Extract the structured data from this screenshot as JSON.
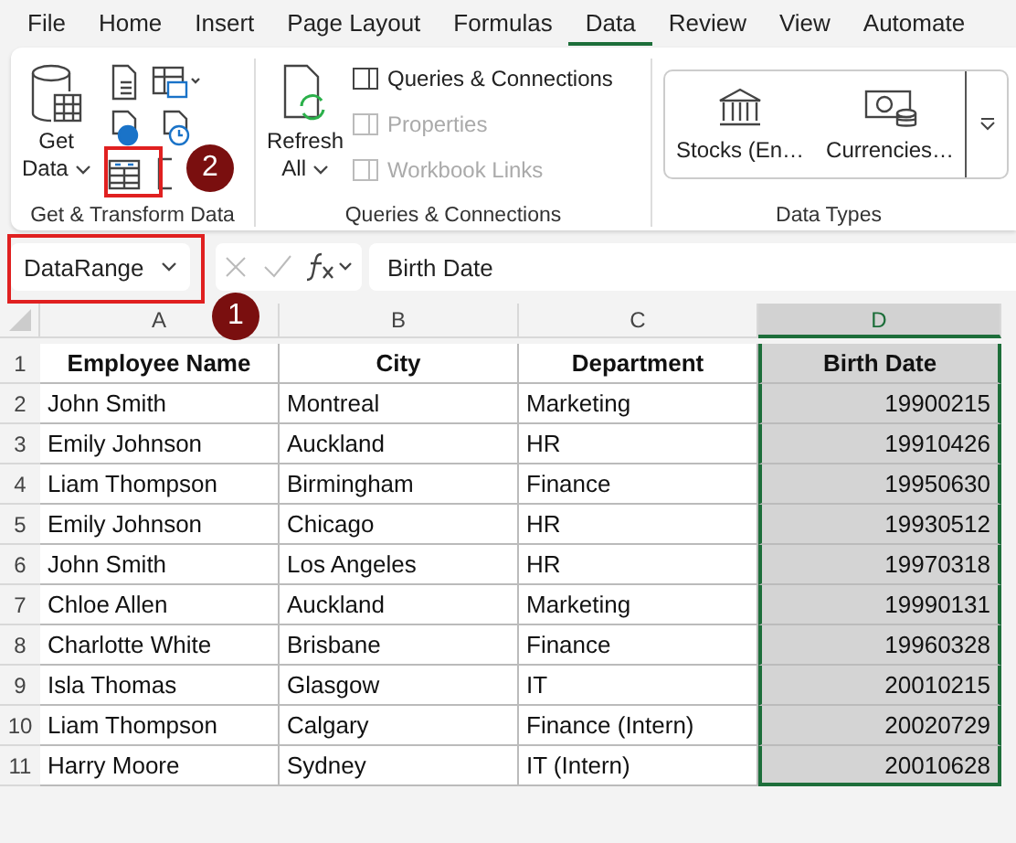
{
  "menu_tabs": [
    {
      "label": "File",
      "selected": false
    },
    {
      "label": "Home",
      "selected": false
    },
    {
      "label": "Insert",
      "selected": false
    },
    {
      "label": "Page Layout",
      "selected": false
    },
    {
      "label": "Formulas",
      "selected": false
    },
    {
      "label": "Data",
      "selected": true
    },
    {
      "label": "Review",
      "selected": false
    },
    {
      "label": "View",
      "selected": false
    },
    {
      "label": "Automate",
      "selected": false
    }
  ],
  "ribbon": {
    "get_transform": {
      "label": "Get & Transform Data",
      "get_data": [
        "Get",
        "Data"
      ]
    },
    "queries": {
      "label": "Queries & Connections",
      "refresh": [
        "Refresh",
        "All"
      ],
      "items": [
        {
          "label": "Queries & Connections",
          "disabled": false
        },
        {
          "label": "Properties",
          "disabled": true
        },
        {
          "label": "Workbook Links",
          "disabled": true
        }
      ]
    },
    "data_types": {
      "label": "Data Types",
      "items": [
        "Stocks (En…",
        "Currencies…"
      ]
    }
  },
  "callouts": [
    "1",
    "2"
  ],
  "name_box": {
    "value": "DataRange"
  },
  "formula_bar": {
    "value": "Birth Date"
  },
  "sheet": {
    "columns": [
      {
        "letter": "A",
        "header": "Employee Name",
        "kind": "text",
        "selected": false
      },
      {
        "letter": "B",
        "header": "City",
        "kind": "text",
        "selected": false
      },
      {
        "letter": "C",
        "header": "Department",
        "kind": "text",
        "selected": false
      },
      {
        "letter": "D",
        "header": "Birth Date",
        "kind": "number",
        "selected": true
      }
    ],
    "header_row_number": "1",
    "rows": [
      {
        "number": "2",
        "cells": [
          "John Smith",
          "Montreal",
          "Marketing",
          "19900215"
        ]
      },
      {
        "number": "3",
        "cells": [
          "Emily Johnson",
          "Auckland",
          "HR",
          "19910426"
        ]
      },
      {
        "number": "4",
        "cells": [
          "Liam Thompson",
          "Birmingham",
          "Finance",
          "19950630"
        ]
      },
      {
        "number": "5",
        "cells": [
          "Emily Johnson",
          "Chicago",
          "HR",
          "19930512"
        ]
      },
      {
        "number": "6",
        "cells": [
          "John Smith",
          "Los Angeles",
          "HR",
          "19970318"
        ]
      },
      {
        "number": "7",
        "cells": [
          "Chloe Allen",
          "Auckland",
          "Marketing",
          "19990131"
        ]
      },
      {
        "number": "8",
        "cells": [
          "Charlotte White",
          "Brisbane",
          "Finance",
          "19960328"
        ]
      },
      {
        "number": "9",
        "cells": [
          "Isla Thomas",
          "Glasgow",
          "IT",
          "20010215"
        ]
      },
      {
        "number": "10",
        "cells": [
          "Liam Thompson",
          "Calgary",
          "Finance (Intern)",
          "20020729"
        ]
      },
      {
        "number": "11",
        "cells": [
          "Harry Moore",
          "Sydney",
          "IT (Intern)",
          "20010628"
        ]
      }
    ]
  }
}
